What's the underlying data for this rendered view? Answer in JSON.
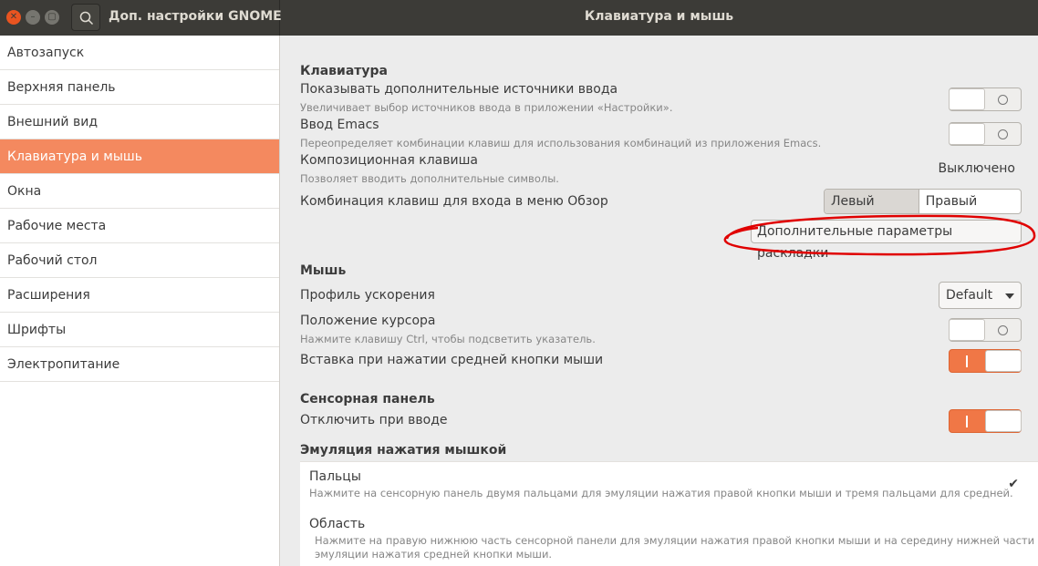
{
  "window": {
    "app_title": "Доп. настройки GNOME",
    "page_title": "Клавиатура и мышь"
  },
  "sidebar": {
    "items": [
      {
        "label": "Автозапуск"
      },
      {
        "label": "Верхняя панель"
      },
      {
        "label": "Внешний вид"
      },
      {
        "label": "Клавиатура и мышь",
        "active": true
      },
      {
        "label": "Окна"
      },
      {
        "label": "Рабочие места"
      },
      {
        "label": "Рабочий стол"
      },
      {
        "label": "Расширения"
      },
      {
        "label": "Шрифты"
      },
      {
        "label": "Электропитание"
      }
    ]
  },
  "keyboard": {
    "section_title": "Клавиатура",
    "extra_sources": {
      "title": "Показывать дополнительные источники ввода",
      "subtitle": "Увеличивает выбор источников ввода в приложении «Настройки».",
      "enabled": false
    },
    "emacs": {
      "title": "Ввод Emacs",
      "subtitle": "Переопределяет комбинации клавиш для использования комбинаций из приложения Emacs.",
      "enabled": false
    },
    "compose": {
      "title": "Композиционная клавиша",
      "subtitle": "Позволяет вводить дополнительные символы.",
      "value": "Выключено"
    },
    "overview": {
      "title": "Комбинация клавиш для входа в меню Обзор",
      "left_label": "Левый Super",
      "right_label": "Правый Super",
      "selected": "Левый Super"
    },
    "layout_button": "Дополнительные параметры раскладки",
    "annotation_color": "#e00000"
  },
  "mouse": {
    "section_title": "Мышь",
    "accel_profile": {
      "title": "Профиль ускорения",
      "value": "Default"
    },
    "pointer_location": {
      "title": "Положение курсора",
      "subtitle": "Нажмите клавишу Ctrl, чтобы подсветить указатель.",
      "enabled": false
    },
    "middle_paste": {
      "title": "Вставка при нажатии средней кнопки мыши",
      "enabled": true
    }
  },
  "touchpad": {
    "section_title": "Сенсорная панель",
    "disable_typing": {
      "title": "Отключить при вводе",
      "enabled": true
    }
  },
  "click_emulation": {
    "section_title": "Эмуляция нажатия мышкой",
    "fingers": {
      "title": "Пальцы",
      "subtitle": "Нажмите на сенсорную панель двумя пальцами для эмуляции нажатия правой кнопки мыши и тремя пальцами для средней.",
      "selected": true,
      "check": "✔"
    },
    "area": {
      "title": "Область",
      "subtitle_line1": "Нажмите на правую нижнюю часть сенсорной панели для эмуляции нажатия правой кнопки мыши и на середину нижней части для",
      "subtitle_line2": "эмуляции нажатия средней кнопки мыши."
    }
  },
  "colors": {
    "accent": "#f07746",
    "sidebar_active": "#f4895f",
    "headerbar": "#3c3b37"
  }
}
